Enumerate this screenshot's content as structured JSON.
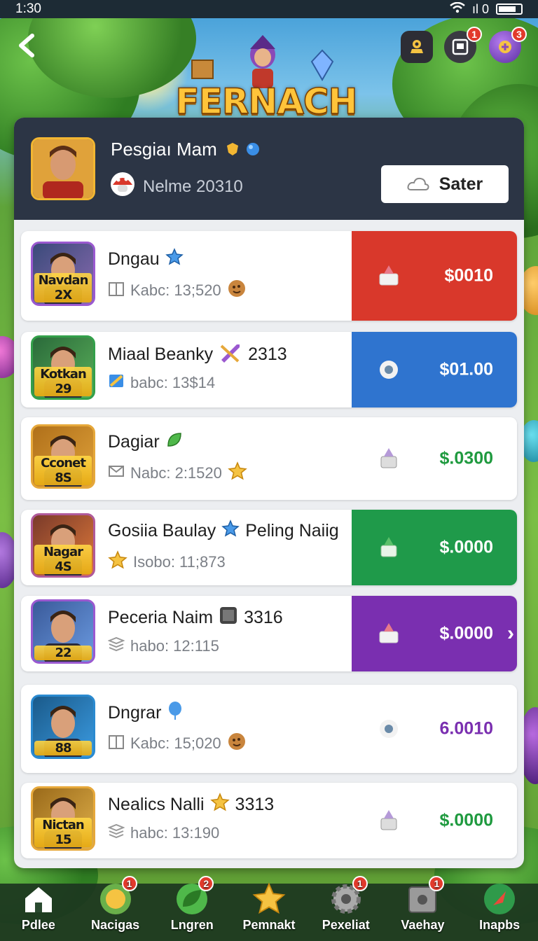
{
  "status_bar": {
    "time": "1:30",
    "signal_text": "ıl 0"
  },
  "header": {
    "logo_text": "FERNACH",
    "icons": [
      {
        "name": "trophy-icon",
        "badge": ""
      },
      {
        "name": "inbox-icon",
        "badge": "1"
      },
      {
        "name": "gift-icon",
        "badge": "3"
      }
    ]
  },
  "profile": {
    "name": "Pesgiaı Mam",
    "subtitle": "Nelme 20310",
    "save_label": "Sater"
  },
  "list": {
    "items": [
      {
        "title": "Dngau",
        "extra": "",
        "subtitle": "Kabc: 13;520",
        "avatar_label": "Navdan 2X",
        "price": "$0010",
        "price_bg": "#d9382b",
        "price_color": "#ffffff",
        "chevron": false,
        "title_icon": "star-badge-icon",
        "sub_icon": "box-icon",
        "sub_end_icon": "cookie-icon"
      },
      {
        "title": "Miaal Beanky",
        "extra": "2313",
        "subtitle": "babc: 13$14",
        "avatar_label": "Kotkan 29",
        "price": "$01.00",
        "price_bg": "#2f74cf",
        "price_color": "#ffffff",
        "chevron": false,
        "title_icon": "sword-icon",
        "sub_icon": "ticket-icon",
        "sub_end_icon": ""
      },
      {
        "title": "Dagiar",
        "extra": "",
        "subtitle": "Nabc: 2:1520",
        "avatar_label": "Cconet 8S",
        "price": "$.0300",
        "price_bg": "#ffffff",
        "price_color": "#1f9a3f",
        "chevron": false,
        "title_icon": "leaf-icon",
        "sub_icon": "mail-icon",
        "sub_end_icon": "star-icon"
      },
      {
        "title": "Gosiia Baulay",
        "extra": "Peling Naiig",
        "subtitle": "Isobo: 11;873",
        "avatar_label": "Nagar 4S",
        "price": "$.0000",
        "price_bg": "#1f9a4a",
        "price_color": "#ffffff",
        "chevron": false,
        "title_icon": "star-badge-icon",
        "sub_icon": "star-icon",
        "sub_end_icon": ""
      },
      {
        "title": "Peceria Naim",
        "extra": "3316",
        "subtitle": "habo: 12:115",
        "avatar_label": "22",
        "price": "$.0000",
        "price_bg": "#7a2fb0",
        "price_color": "#ffffff",
        "chevron": true,
        "title_icon": "console-icon",
        "sub_icon": "stack-icon",
        "sub_end_icon": ""
      },
      {
        "title": "Dngrar",
        "extra": "",
        "subtitle": "Kabc: 15;020",
        "avatar_label": "88",
        "price": "6.0010",
        "price_bg": "#ffffff",
        "price_color": "#7a2fb0",
        "chevron": false,
        "title_icon": "balloon-icon",
        "sub_icon": "box-icon",
        "sub_end_icon": "cookie-icon"
      },
      {
        "title": "Nealics Nalli",
        "extra": "3313",
        "subtitle": "habc: 13:190",
        "avatar_label": "Nictan 15",
        "price": "$.0000",
        "price_bg": "#ffffff",
        "price_color": "#1f9a3f",
        "chevron": false,
        "title_icon": "star-icon",
        "sub_icon": "stack-icon",
        "sub_end_icon": ""
      }
    ]
  },
  "bottom_nav": {
    "items": [
      {
        "label": "Pdlee",
        "badge": "",
        "icon": "home-icon"
      },
      {
        "label": "Nacigas",
        "badge": "1",
        "icon": "gold-orb-icon"
      },
      {
        "label": "Lngren",
        "badge": "2",
        "icon": "leaf-orb-icon"
      },
      {
        "label": "Pemnakt",
        "badge": "",
        "icon": "star-icon"
      },
      {
        "label": "Pexeliat",
        "badge": "1",
        "icon": "gear-icon"
      },
      {
        "label": "Vaehay",
        "badge": "1",
        "icon": "safe-icon"
      },
      {
        "label": "Inapbs",
        "badge": "",
        "icon": "rocket-orb-icon"
      }
    ]
  }
}
